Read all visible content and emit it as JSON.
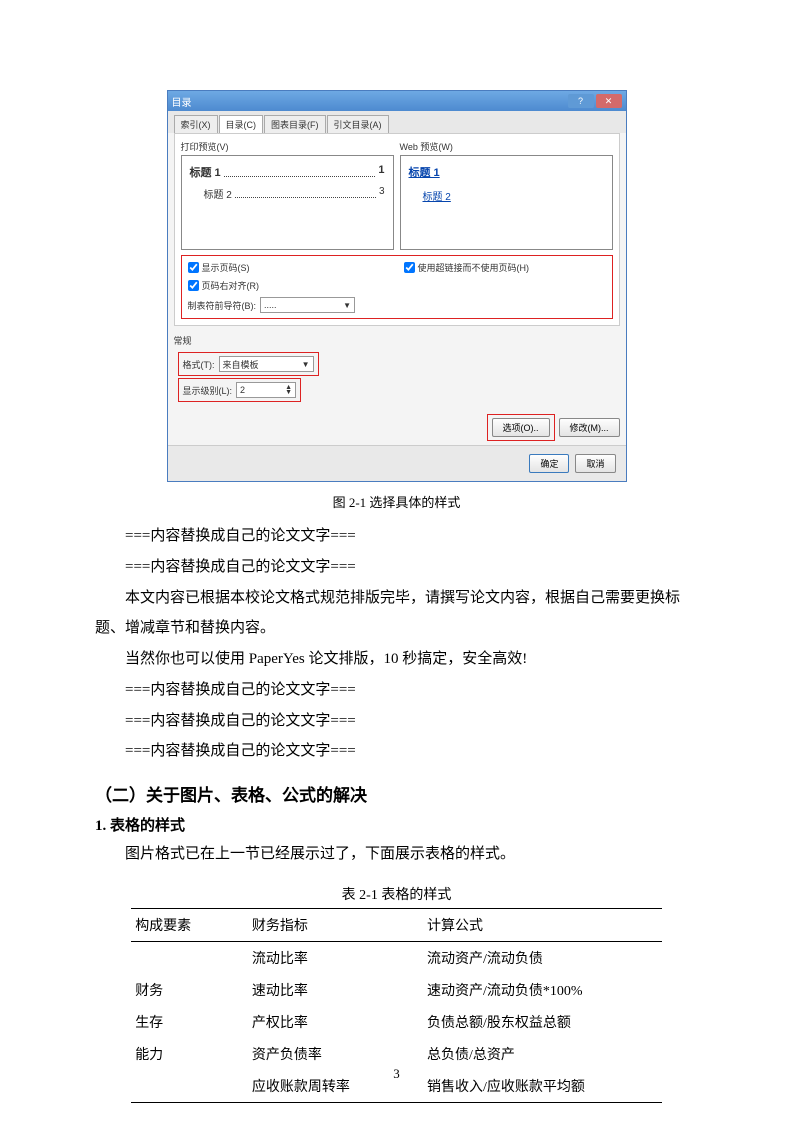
{
  "dialog": {
    "title": "目录",
    "tabs": [
      "索引(X)",
      "目录(C)",
      "图表目录(F)",
      "引文目录(A)"
    ],
    "preview_left_label": "打印预览(V)",
    "preview_right_label": "Web 预览(W)",
    "toc_lines": [
      {
        "text": "标题 1",
        "page": "1",
        "bold": true
      },
      {
        "text": "标题 2",
        "page": "3",
        "bold": false
      }
    ],
    "web_links": [
      "标题 1",
      "标题 2"
    ],
    "chk_show_pagenum": "显示页码(S)",
    "chk_right_align": "页码右对齐(R)",
    "leader_label": "制表符前导符(B):",
    "leader_value": ".....",
    "chk_hyperlink": "使用超链接而不使用页码(H)",
    "general_title": "常规",
    "format_label": "格式(T):",
    "format_value": "来自模板",
    "levels_label": "显示级别(L):",
    "levels_value": "2",
    "btn_options": "选项(O)..",
    "btn_modify": "修改(M)...",
    "btn_ok": "确定",
    "btn_cancel": "取消"
  },
  "caption1": "图 2-1 选择具体的样式",
  "paras": [
    "===内容替换成自己的论文文字===",
    "===内容替换成自己的论文文字===",
    "本文内容已根据本校论文格式规范排版完毕，请撰写论文内容，根据自己需要更换标题、增减章节和替换内容。",
    "当然你也可以使用 PaperYes 论文排版，10 秒搞定，安全高效!",
    "===内容替换成自己的论文文字===",
    "===内容替换成自己的论文文字===",
    "===内容替换成自己的论文文字==="
  ],
  "h2": "（二）关于图片、表格、公式的解决",
  "h3": "1. 表格的样式",
  "para_after_h3": "图片格式已在上一节已经展示过了，下面展示表格的样式。",
  "table_caption": "表 2-1 表格的样式",
  "table": {
    "headers": [
      "构成要素",
      "财务指标",
      "计算公式"
    ],
    "rows": [
      [
        "",
        "流动比率",
        "流动资产/流动负债"
      ],
      [
        "财务",
        "速动比率",
        "速动资产/流动负债*100%"
      ],
      [
        "生存",
        "产权比率",
        "负债总额/股东权益总额"
      ],
      [
        "能力",
        "资产负债率",
        "总负债/总资产"
      ],
      [
        "",
        "应收账款周转率",
        "销售收入/应收账款平均额"
      ]
    ]
  },
  "pagenum": "3"
}
